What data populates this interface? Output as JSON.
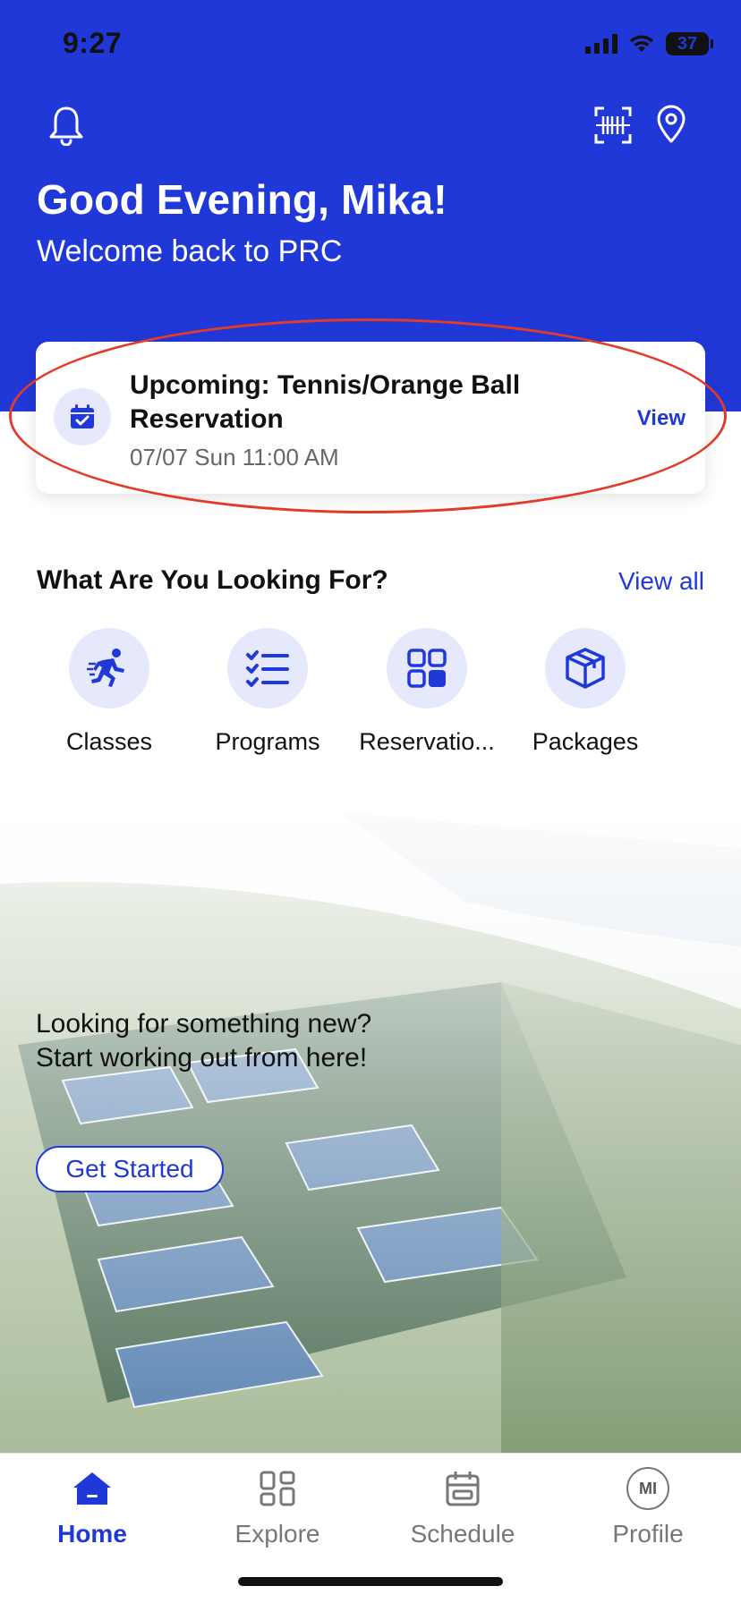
{
  "status_bar": {
    "time": "9:27",
    "battery": "37"
  },
  "header": {
    "greeting": "Good Evening, Mika!",
    "welcome": "Welcome back to PRC",
    "icons": [
      "bell-icon",
      "barcode-scan-icon",
      "location-pin-icon"
    ]
  },
  "upcoming": {
    "title": "Upcoming: Tennis/Orange Ball Reservation",
    "datetime": "07/07 Sun 11:00 AM",
    "view_label": "View"
  },
  "looking_for": {
    "title": "What Are You Looking For?",
    "view_all_label": "View all",
    "categories": [
      {
        "label": "Classes",
        "icon": "running-person-icon"
      },
      {
        "label": "Programs",
        "icon": "checklist-icon"
      },
      {
        "label": "Reservatio...",
        "icon": "grid-icon"
      },
      {
        "label": "Packages",
        "icon": "package-box-icon"
      }
    ]
  },
  "promo": {
    "line1": "Looking for something new?",
    "line2": "Start working out from here!",
    "button_label": "Get Started"
  },
  "tabbar": {
    "tabs": [
      {
        "label": "Home",
        "icon": "home-icon",
        "active": true
      },
      {
        "label": "Explore",
        "icon": "explore-grid-icon",
        "active": false
      },
      {
        "label": "Schedule",
        "icon": "calendar-icon",
        "active": false
      },
      {
        "label": "Profile",
        "icon": "avatar-icon",
        "active": false,
        "initials": "MI"
      }
    ]
  },
  "colors": {
    "brand": "#2138d9",
    "brand_light": "#e6e9fb",
    "annotation": "#e23b2a"
  }
}
